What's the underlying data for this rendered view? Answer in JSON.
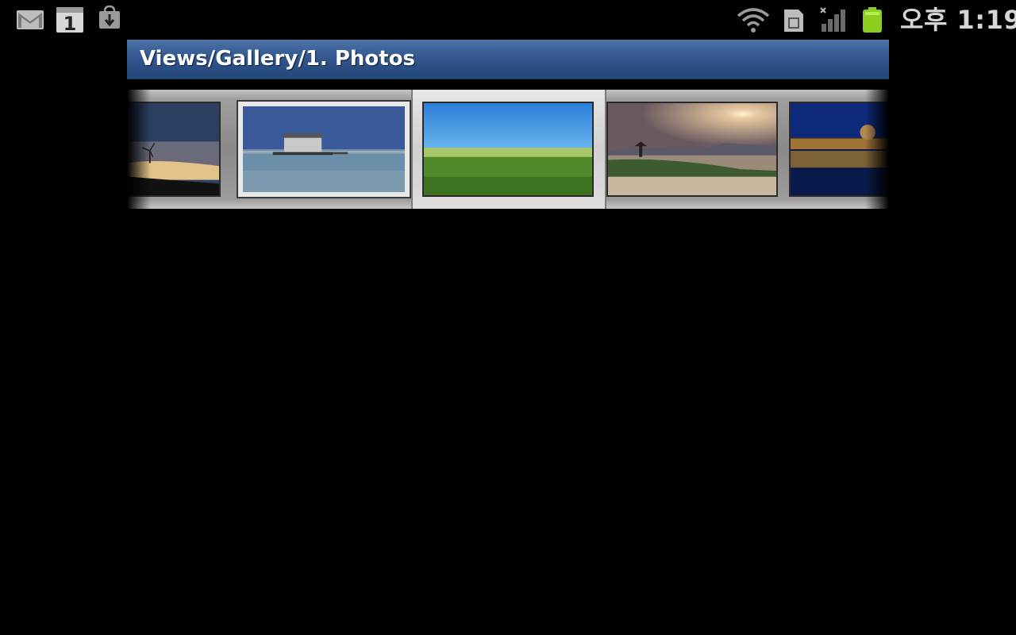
{
  "status_bar": {
    "icons": [
      "gmail-icon",
      "calendar-icon",
      "download-icon",
      "wifi-icon",
      "sim-card-icon",
      "signal-icon",
      "battery-icon"
    ],
    "calendar_day": "1",
    "time": "오후 1:19"
  },
  "title_bar": {
    "title": "Views/Gallery/1. Photos"
  },
  "gallery": {
    "items": [
      {
        "subject": "windmill shoreline photo"
      },
      {
        "subject": "boathouse on lake photo"
      },
      {
        "subject": "green field blue sky photo"
      },
      {
        "subject": "sunset pavilion coast photo"
      },
      {
        "subject": "night cityscape reflection photo"
      }
    ],
    "selected_index": 2
  },
  "colors": {
    "title_bar": "#2f538a",
    "battery": "#8ccf1e"
  }
}
